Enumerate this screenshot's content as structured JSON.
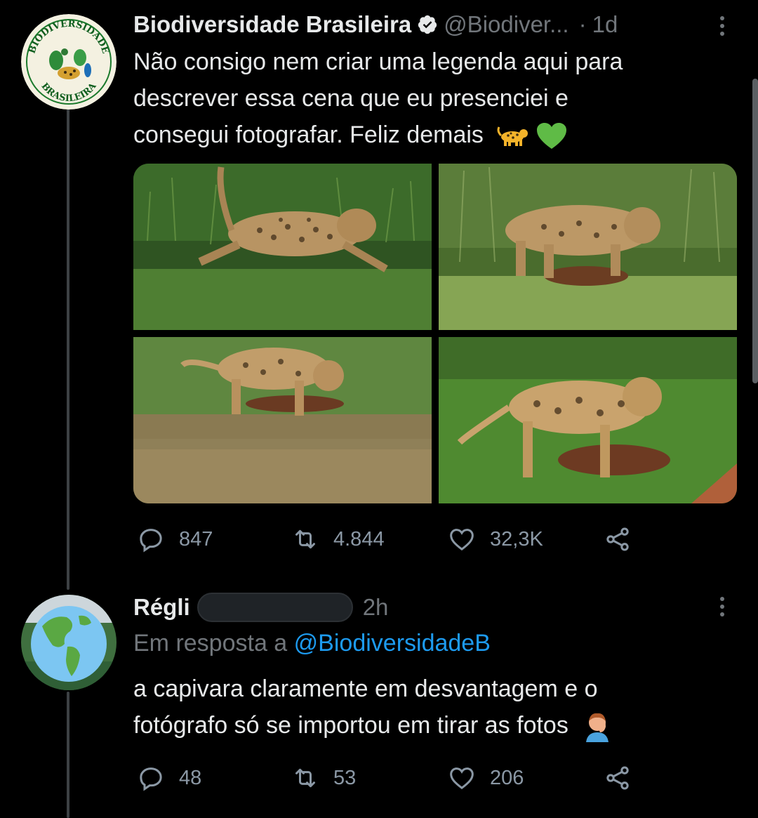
{
  "tweet": {
    "display_name": "Biodiversidade Brasileira",
    "handle": "@Biodiver...",
    "separator": "·",
    "time": "1d",
    "avatar": {
      "label_top": "BIODIVERSIDADE",
      "label_bottom": "BRASILEIRA"
    },
    "text_line1": "Não consigo nem criar uma legenda aqui para",
    "text_line2": "descrever essa cena que eu presenciei e",
    "text_line3": "consegui fotografar. Feliz demais",
    "emojis": [
      "leopard-emoji",
      "green-heart-emoji"
    ],
    "stats": {
      "replies": "847",
      "retweets": "4.844",
      "likes": "32,3K"
    }
  },
  "reply": {
    "display_name": "Régli",
    "time": "2h",
    "reply_prefix": "Em resposta a",
    "reply_to": "@BiodiversidadeB",
    "text_line1": "a capivara claramente em desvantagem e o",
    "text_line2": "fotógrafo só se importou em tirar as fotos",
    "emojis": [
      "face-palm-emoji"
    ],
    "stats": {
      "replies": "48",
      "retweets": "53",
      "likes": "206"
    }
  },
  "colors": {
    "background": "#000000",
    "text": "#e7e9ea",
    "muted": "#71767b",
    "link": "#1d9bf0",
    "thread_line": "#3d4144"
  }
}
